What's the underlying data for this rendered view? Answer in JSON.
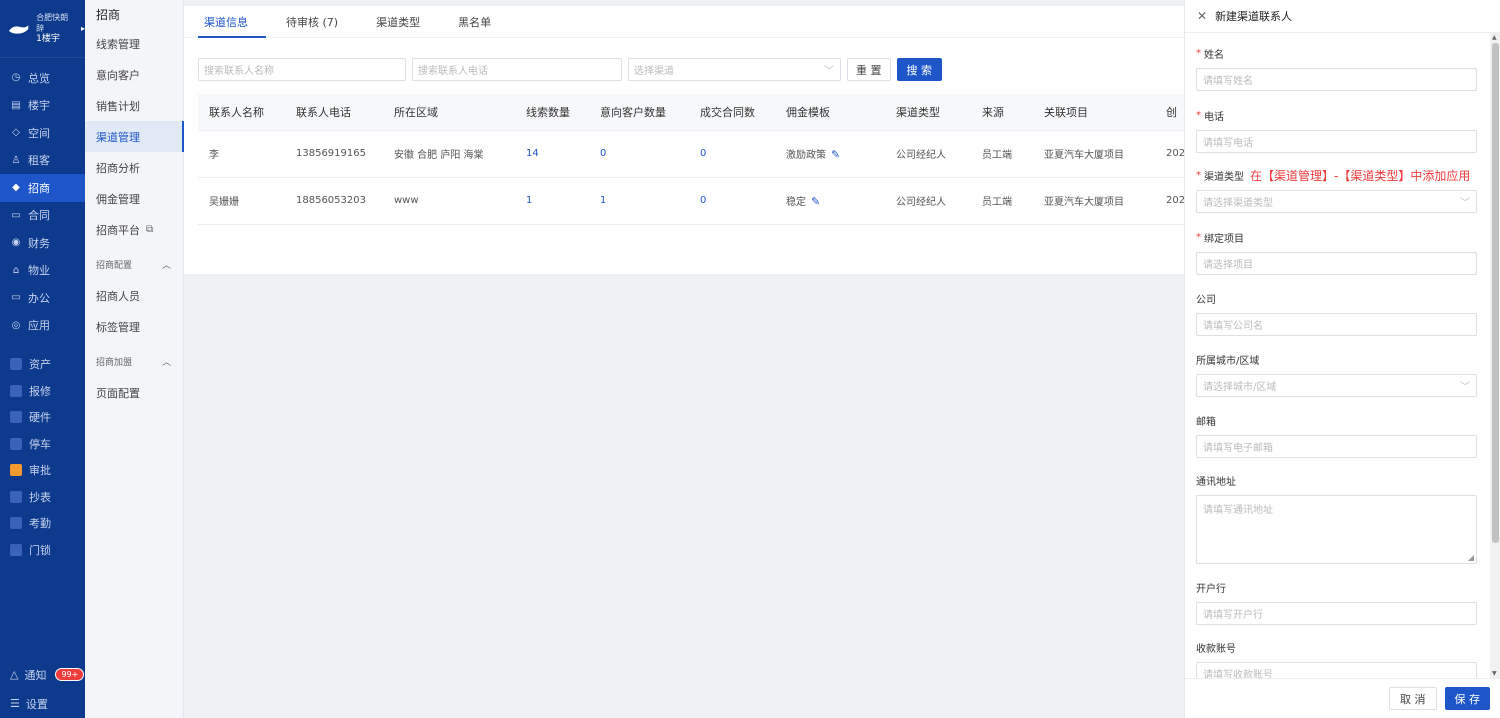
{
  "brand": {
    "name": "合肥快朗辞",
    "sub": "1楼宇"
  },
  "rail": {
    "items": [
      {
        "icon": "clock-icon",
        "glyph": "◷",
        "label": "总览"
      },
      {
        "icon": "building-icon",
        "glyph": "▤",
        "label": "楼宇"
      },
      {
        "icon": "cube-icon",
        "glyph": "◇",
        "label": "空间"
      },
      {
        "icon": "people-icon",
        "glyph": "♙",
        "label": "租客"
      },
      {
        "icon": "diamond-icon",
        "glyph": "◆",
        "label": "招商"
      },
      {
        "icon": "doc-icon",
        "glyph": "▭",
        "label": "合同"
      },
      {
        "icon": "coin-icon",
        "glyph": "◉",
        "label": "财务"
      },
      {
        "icon": "house-icon",
        "glyph": "⌂",
        "label": "物业"
      },
      {
        "icon": "monitor-icon",
        "glyph": "▭",
        "label": "办公"
      },
      {
        "icon": "app-icon",
        "glyph": "◎",
        "label": "应用"
      }
    ],
    "items2": [
      "资产",
      "报修",
      "硬件",
      "停车",
      "审批",
      "抄表",
      "考勤",
      "门锁"
    ],
    "notify": "通知",
    "notify_badge": "99+",
    "settings": "设置"
  },
  "side": {
    "title": "招商",
    "items": [
      "线索管理",
      "意向客户",
      "销售计划",
      "渠道管理",
      "招商分析",
      "佣金管理",
      "招商平台"
    ],
    "group1": "招商配置",
    "group1_items": [
      "招商人员",
      "标签管理"
    ],
    "group2": "招商加盟",
    "group2_items": [
      "页面配置"
    ]
  },
  "tabs": [
    "渠道信息",
    "待审核 (7)",
    "渠道类型",
    "黑名单"
  ],
  "filters": {
    "name_ph": "搜索联系人名称",
    "phone_ph": "搜索联系人电话",
    "channel_ph": "选择渠道",
    "reset": "重 置",
    "search": "搜 索"
  },
  "table": {
    "headers": [
      "联系人名称",
      "联系人电话",
      "所在区域",
      "线索数量",
      "意向客户数量",
      "成交合同数",
      "佣金模板",
      "渠道类型",
      "来源",
      "关联项目",
      "创"
    ],
    "rows": [
      [
        "李",
        "13856919165",
        "安徽 合肥 庐阳 海棠",
        "14",
        "0",
        "0",
        "激励政策",
        "公司经纪人",
        "员工端",
        "亚夏汽车大厦项目",
        "202"
      ],
      [
        "吴姗姗",
        "18856053203",
        "www",
        "1",
        "1",
        "0",
        "稳定",
        "公司经纪人",
        "员工端",
        "亚夏汽车大厦项目",
        "202"
      ]
    ]
  },
  "drawer": {
    "title": "新建渠道联系人",
    "name_label": "姓名",
    "name_ph": "请填写姓名",
    "phone_label": "电话",
    "phone_ph": "请填写电话",
    "type_label": "渠道类型",
    "type_hint": "在【渠道管理】-【渠道类型】中添加应用",
    "type_ph": "请选择渠道类型",
    "project_label": "绑定项目",
    "project_ph": "请选择项目",
    "company_label": "公司",
    "company_ph": "请填写公司名",
    "city_label": "所属城市/区域",
    "city_ph": "请选择城市/区域",
    "email_label": "邮箱",
    "email_ph": "请填写电子邮箱",
    "address_label": "通讯地址",
    "address_ph": "请填写通讯地址",
    "bank_label": "开户行",
    "bank_ph": "请填写开户行",
    "account_label": "收款账号",
    "account_ph": "请填写收款账号",
    "cancel": "取 消",
    "save": "保 存"
  },
  "colors": {
    "primary": "#1e56c9",
    "rail": "#0d3a8c",
    "danger": "#ee3b3b"
  }
}
